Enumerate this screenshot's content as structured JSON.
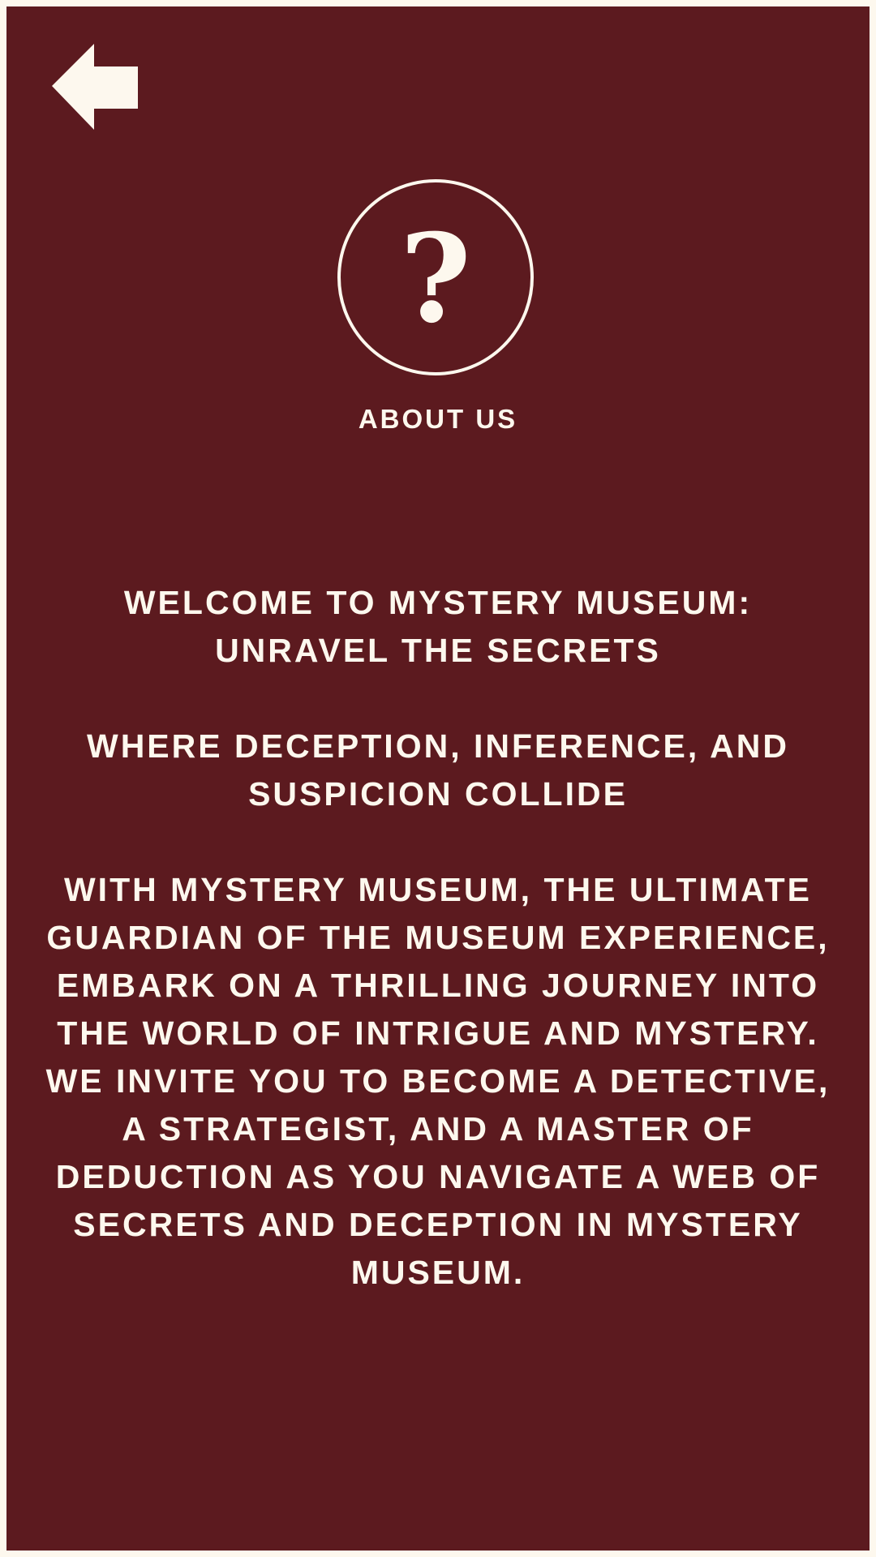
{
  "colors": {
    "background": "#5c1a1f",
    "foreground": "#fdf8ee",
    "frame": "#fdf8ee"
  },
  "header": {
    "back_icon": "arrow-left-icon",
    "badge_icon": "question-mark-icon",
    "badge_glyph": "?",
    "title": "ABOUT US"
  },
  "content": {
    "heading": "WELCOME TO MYSTERY MUSEUM: UNRAVEL THE SECRETS",
    "tagline": "WHERE DECEPTION, INFERENCE, AND SUSPICION COLLIDE",
    "body": "WITH MYSTERY MUSEUM, THE ULTIMATE GUARDIAN OF THE MUSEUM EXPERIENCE, EMBARK ON A THRILLING JOURNEY INTO THE WORLD OF INTRIGUE AND MYSTERY. WE INVITE YOU TO BECOME A DETECTIVE, A STRATEGIST, AND A MASTER OF DEDUCTION AS YOU NAVIGATE A WEB OF SECRETS AND DECEPTION IN MYSTERY MUSEUM."
  }
}
